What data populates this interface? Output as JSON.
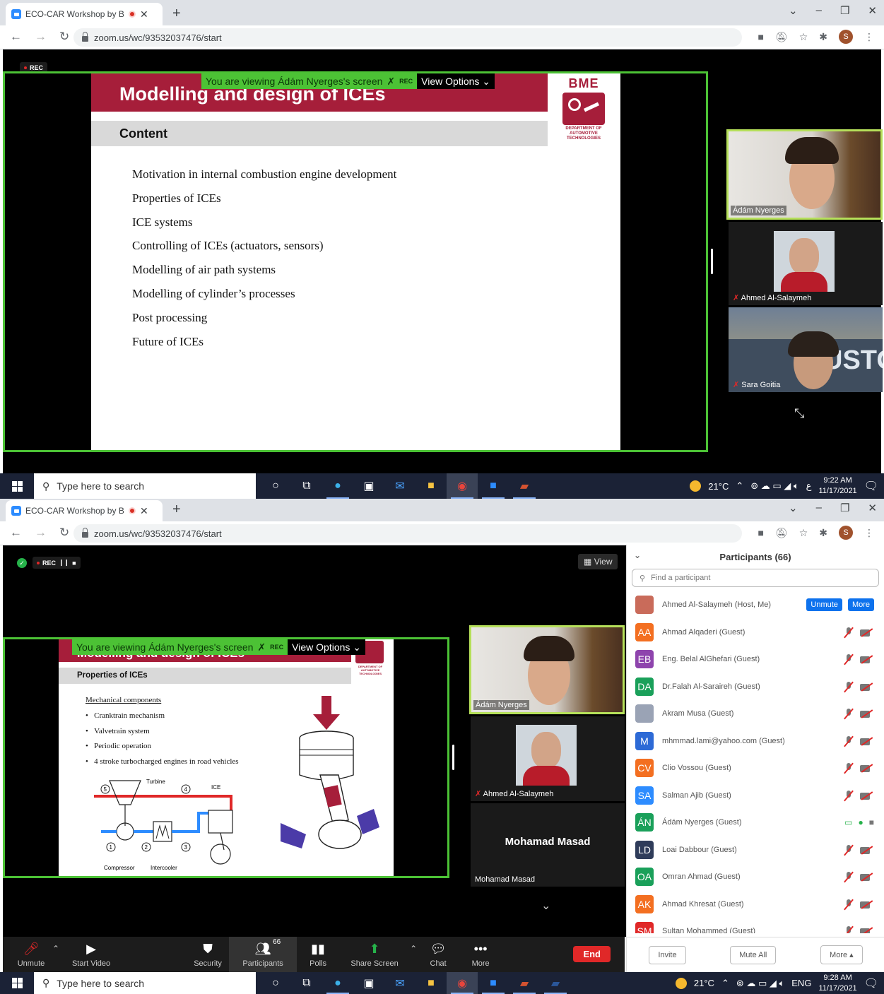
{
  "browser": {
    "tab_title": "ECO-CAR Workshop by BME",
    "url": "zoom.us/wc/93532037476/start",
    "profile_initial": "S"
  },
  "screen1": {
    "rec_label": "REC",
    "viewing_text": "You are viewing Ádám Nyerges's screen",
    "viewing_rec": "REC",
    "view_options": "View Options",
    "slide": {
      "title": "Modelling and design of ICEs",
      "section": "Content",
      "logo_top": "BME",
      "logo_caption": "DEPARTMENT OF AUTOMOTIVE TECHNOLOGIES",
      "items": [
        "Motivation in internal combustion engine development",
        "Properties of ICEs",
        "ICE systems",
        "Controlling of ICEs (actuators, sensors)",
        "Modelling of air path systems",
        "Modelling of cylinder’s processes",
        "Post processing",
        "Future of ICEs"
      ]
    },
    "tiles": [
      "Ádám Nyerges",
      "Ahmed Al-Salaymeh",
      "Sara Goitia"
    ],
    "tile_bg_text": "USTO"
  },
  "taskbar1": {
    "search_placeholder": "Type here to search",
    "temp": "21°C",
    "lang": "ع",
    "time": "9:22 AM",
    "date": "11/17/2021"
  },
  "screen2": {
    "rec_label": "REC",
    "view_label": "View",
    "viewing_text": "You are viewing Ádám Nyerges's screen",
    "viewing_rec": "REC",
    "view_options": "View Options",
    "slide": {
      "title": "Modelling and design of ICEs",
      "section": "Properties of ICEs",
      "subheading": "Mechanical components",
      "bullets": [
        "Cranktrain mechanism",
        "Valvetrain system",
        "Periodic operation",
        "4 stroke turbocharged engines in road vehicles"
      ],
      "diagram": {
        "turbine": "Turbine",
        "ice": "ICE",
        "compressor": "Compressor",
        "intercooler": "Intercooler",
        "n1": "1",
        "n2": "2",
        "n3": "3",
        "n4": "4",
        "n5": "5"
      }
    },
    "tiles": [
      "Ádám Nyerges",
      "Ahmed Al-Salaymeh"
    ],
    "big_name": "Mohamad Masad",
    "small_name": "Mohamad Masad"
  },
  "controls": {
    "unmute": "Unmute",
    "start_video": "Start Video",
    "security": "Security",
    "participants": "Participants",
    "participants_count": "66",
    "polls": "Polls",
    "share_screen": "Share Screen",
    "chat": "Chat",
    "more": "More",
    "end": "End"
  },
  "panel": {
    "title": "Participants (66)",
    "search_placeholder": "Find a participant",
    "unmute_btn": "Unmute",
    "more_btn": "More",
    "participants": [
      {
        "initials": "",
        "name": "Ahmed Al-Salaymeh (Host, Me)",
        "color": "#c96b5a"
      },
      {
        "initials": "AA",
        "name": "Ahmad Alqaderi (Guest)",
        "color": "#f36f21"
      },
      {
        "initials": "EB",
        "name": "Eng. Belal AlGhefari (Guest)",
        "color": "#8e44ad"
      },
      {
        "initials": "DA",
        "name": "Dr.Falah Al-Saraireh (Guest)",
        "color": "#1aa05a"
      },
      {
        "initials": "",
        "name": "Akram Musa (Guest)",
        "color": "#9aa3b5"
      },
      {
        "initials": "M",
        "name": "mhmmad.lami@yahoo.com (Guest)",
        "color": "#2d6ad6"
      },
      {
        "initials": "CV",
        "name": "Clio Vossou (Guest)",
        "color": "#f36f21"
      },
      {
        "initials": "SA",
        "name": "Salman Ajib (Guest)",
        "color": "#2d8cff"
      },
      {
        "initials": "ÁN",
        "name": "Ádám Nyerges (Guest)",
        "color": "#1aa05a"
      },
      {
        "initials": "LD",
        "name": "Loai Dabbour (Guest)",
        "color": "#2f3c5a"
      },
      {
        "initials": "OA",
        "name": "Omran Ahmad (Guest)",
        "color": "#1aa05a"
      },
      {
        "initials": "AK",
        "name": "Ahmad Khresat (Guest)",
        "color": "#f36f21"
      },
      {
        "initials": "SM",
        "name": "Sultan Mohammed (Guest)",
        "color": "#e02828"
      }
    ],
    "invite": "Invite",
    "mute_all": "Mute All",
    "more_foot": "More"
  },
  "taskbar2": {
    "search_placeholder": "Type here to search",
    "temp": "21°C",
    "lang": "ENG",
    "time": "9:28 AM",
    "date": "11/17/2021"
  }
}
